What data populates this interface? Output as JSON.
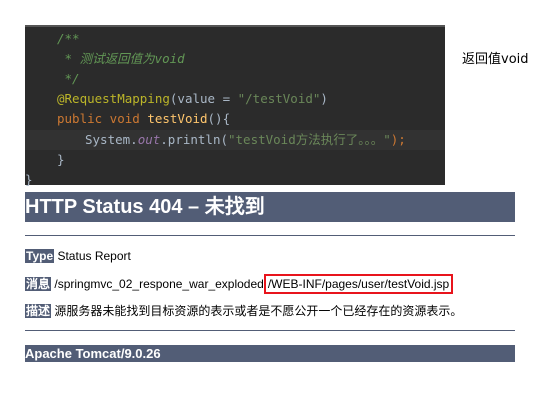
{
  "code": {
    "lines": [
      {
        "t": "/**"
      },
      {
        "t": " * 测试返回值为void"
      },
      {
        "t": " */"
      },
      {
        "anno": "@RequestMapping",
        "args1": "(value = ",
        "str": "\"/testVoid\"",
        "args2": ")"
      },
      {
        "kw": "public void ",
        "fn": "testVoid",
        "rest": "(){"
      },
      {
        "a": "System.",
        "b": "out",
        "c": ".println(",
        "s": "\"testVoid方法执行了。。。\"",
        "e": ");"
      },
      {
        "t": "}"
      },
      {
        "t": "}"
      }
    ]
  },
  "note": "返回值void",
  "error_page": {
    "title": "HTTP Status 404 – 未找到",
    "type_label": "Type",
    "type_value": "Status Report",
    "message_label": "消息",
    "message_prefix": "/springmvc_02_respone_war_exploded",
    "message_highlight": "/WEB-INF/pages/user/testVoid.jsp",
    "desc_label": "描述",
    "desc_value": "源服务器未能找到目标资源的表示或者是不愿公开一个已经存在的资源表示。",
    "footer": "Apache Tomcat/9.0.26",
    "highlight_color": "#e8141c"
  }
}
